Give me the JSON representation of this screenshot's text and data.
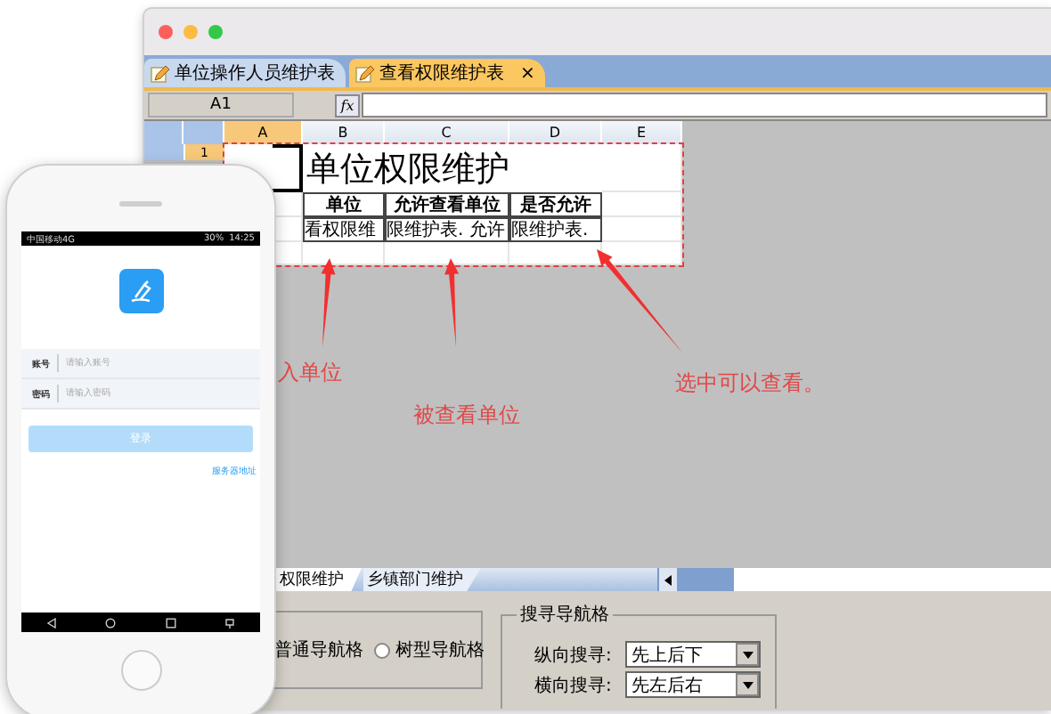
{
  "window": {
    "tabs": [
      {
        "label": "单位操作人员维护表",
        "selected": false
      },
      {
        "label": "查看权限维护表",
        "selected": true,
        "close": "×"
      }
    ]
  },
  "formula_bar": {
    "cell_ref": "A1",
    "fx": "fx"
  },
  "sheet": {
    "columns": [
      {
        "label": "A",
        "selected": true
      },
      {
        "label": "B",
        "selected": false
      },
      {
        "label": "C",
        "selected": false
      },
      {
        "label": "D",
        "selected": false
      },
      {
        "label": "E",
        "selected": false
      }
    ],
    "row_header": "1",
    "title": "单位权限维护",
    "header_cells": [
      "单位",
      "允许查看单位",
      "是否允许"
    ],
    "value_cells": [
      "看权限维",
      "限维护表. 允许",
      "限维护表."
    ]
  },
  "annotations": [
    {
      "text": "入单位"
    },
    {
      "text": "被查看单位"
    },
    {
      "text": "选中可以查看。"
    }
  ],
  "sheet_tabs": [
    {
      "label": "权限维护",
      "selected": true
    },
    {
      "label": "乡镇部门维护",
      "selected": false
    }
  ],
  "nav_mode": {
    "cut_label": "普通导航格",
    "radio": {
      "label": "树型导航格",
      "selected": false
    }
  },
  "search_group": {
    "title": "搜寻导航格",
    "fields": [
      {
        "label": "纵向搜寻:",
        "value": "先上后下"
      },
      {
        "label": "横向搜寻:",
        "value": "先左后右"
      }
    ]
  },
  "phone": {
    "status": {
      "carrier": "中国移动4G",
      "battery": "30%",
      "time": "14:25"
    },
    "fields": [
      {
        "label": "账号",
        "placeholder": "请输入账号"
      },
      {
        "label": "密码",
        "placeholder": "请输入密码"
      }
    ],
    "login_button": {
      "label": "登录",
      "disabled": true
    },
    "link": "服务器地址"
  }
}
